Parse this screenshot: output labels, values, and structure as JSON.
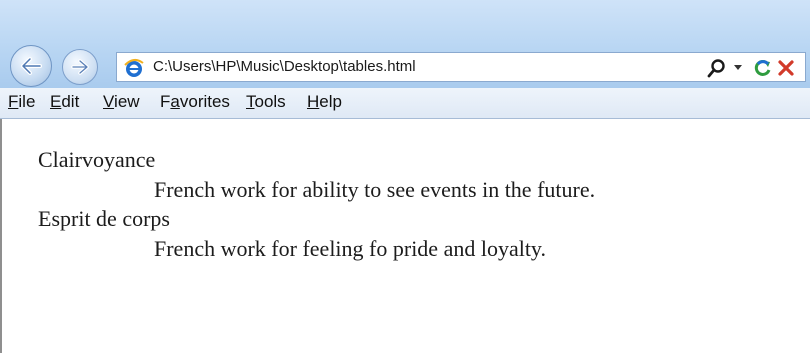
{
  "browser": {
    "address": "C:\\Users\\HP\\Music\\Desktop\\tables.html",
    "icons": [
      "back-icon",
      "forward-icon",
      "ie-icon",
      "search-icon",
      "dropdown-icon",
      "refresh-icon",
      "stop-icon"
    ]
  },
  "menu": {
    "file": {
      "u": "F",
      "rest": "ile"
    },
    "edit": {
      "u": "E",
      "rest": "dit"
    },
    "view": {
      "u": "V",
      "rest": "iew"
    },
    "favorites": {
      "pre": "F",
      "u": "a",
      "rest": "vorites"
    },
    "tools": {
      "u": "T",
      "rest": "ools"
    },
    "help": {
      "u": "H",
      "rest": "elp"
    }
  },
  "definitions": [
    {
      "term": "Clairvoyance",
      "description": "French work for ability to see events in the future."
    },
    {
      "term": "Esprit de corps",
      "description": "French work for feeling fo pride and loyalty."
    }
  ],
  "colors": {
    "chrome": "#b9d6f3",
    "accent_blue": "#1f6fd1",
    "refresh_green": "#2f9c3f",
    "stop_red": "#d23a2a"
  }
}
